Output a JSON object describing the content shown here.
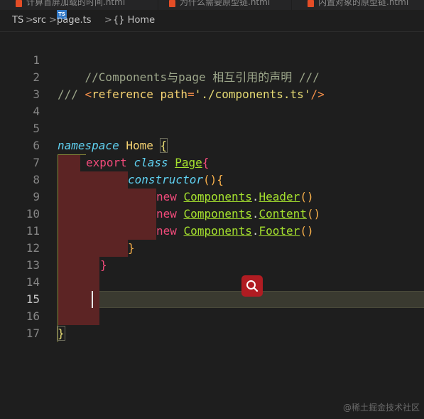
{
  "tabs": [
    {
      "label": "计算首屏加载的时间.html"
    },
    {
      "label": "为什么需要原型链.html"
    },
    {
      "label": "内置对象的原型链.html"
    }
  ],
  "breadcrumb": {
    "root": "TS",
    "folder": "src",
    "file": "page.ts",
    "file_icon": "TS",
    "symbol": "{} Home",
    "separator": ">"
  },
  "editor": {
    "active_line": "15",
    "line_numbers": [
      "1",
      "2",
      "3",
      "4",
      "5",
      "6",
      "7",
      "8",
      "9",
      "10",
      "11",
      "12",
      "13",
      "14",
      "15",
      "16",
      "17"
    ],
    "code": {
      "l1_comment": "//Components与page 相互引用的声明 ///",
      "l3_slashes": "/// ",
      "l3_open": "<",
      "l3_tag": "reference",
      "l3_attr": " path",
      "l3_eq": "=",
      "l3_str": "'./components.ts'",
      "l3_close": "/>",
      "l6_kw": "namespace",
      "l6_name": "Home",
      "l6_brace": "{",
      "l7_export": "export",
      "l7_class": "class",
      "l7_name": "Page",
      "l7_brace": "{",
      "l8_ctor": "constructor",
      "l8_parens": "()",
      "l8_brace": "{",
      "new_kw": "new",
      "components": "Components",
      "dot": ".",
      "header": "Header",
      "content": "Content",
      "footer": "Footer",
      "call_parens": "()",
      "close_brace": "}"
    }
  },
  "colors": {
    "background": "#1e1e1e",
    "selection_block": "#5c2424",
    "search_button": "#b01c22"
  },
  "icons": {
    "search": "search-icon",
    "file_type": "typescript-icon",
    "tab_file": "html5-icon"
  },
  "watermark": "@稀土掘金技术社区"
}
